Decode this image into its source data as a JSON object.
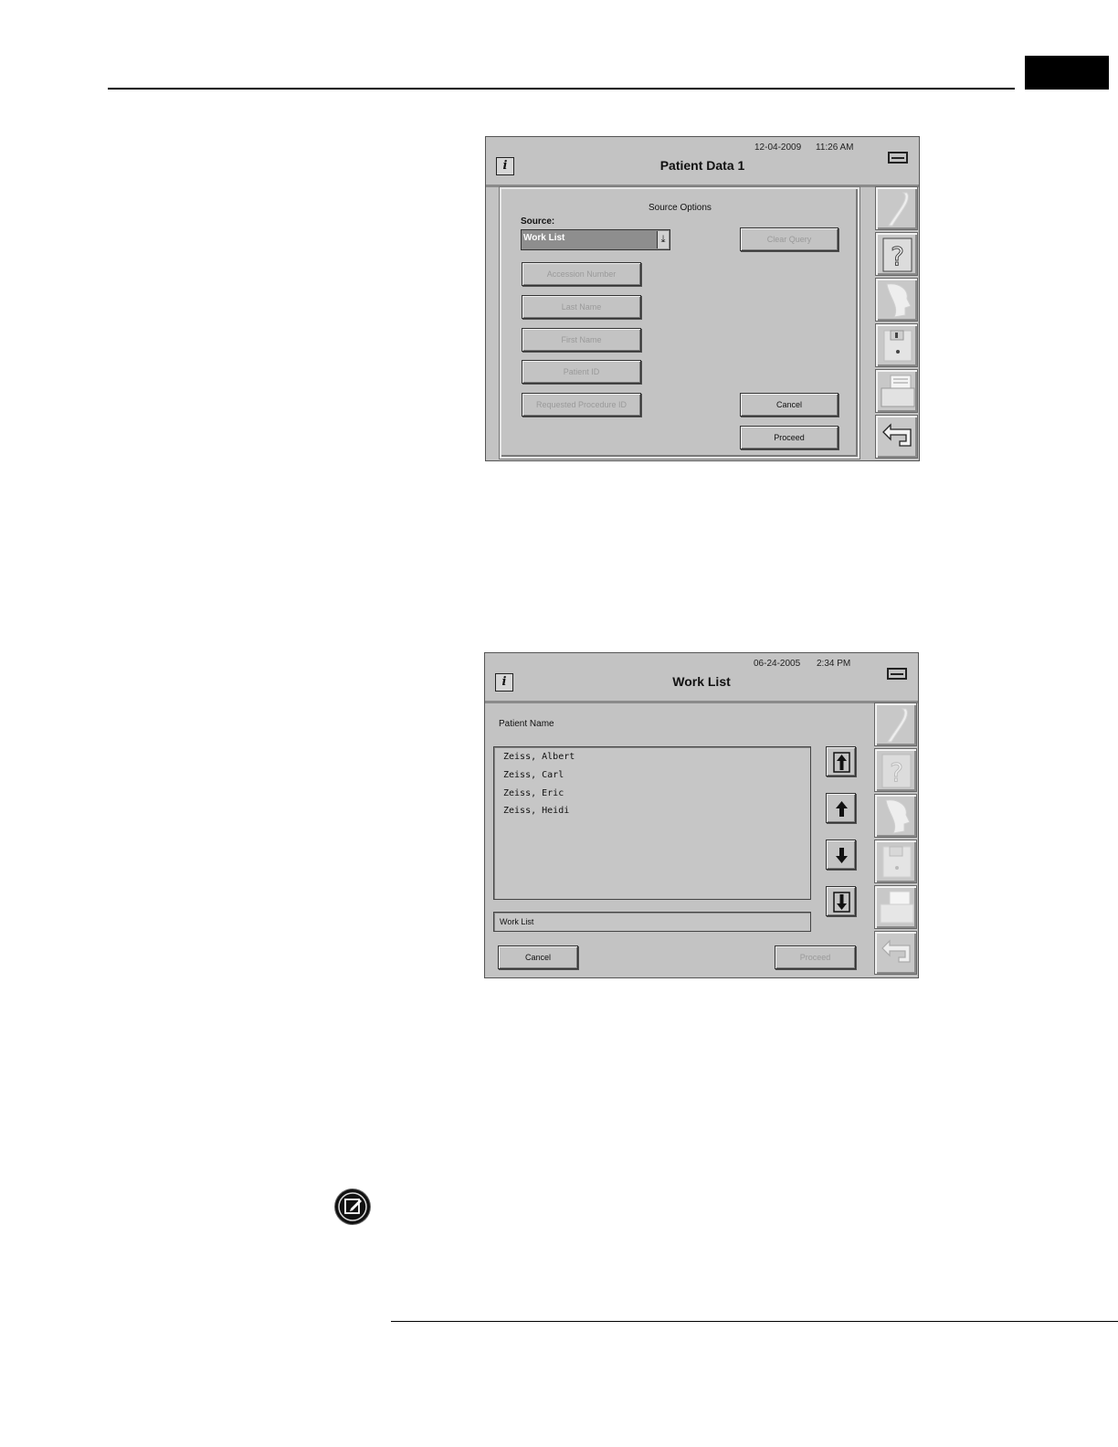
{
  "screen1": {
    "date": "12-04-2009",
    "time": "11:26 AM",
    "title": "Patient Data 1",
    "dialog": {
      "heading": "Source Options",
      "source_label": "Source:",
      "source_value": "Work List",
      "buttons": {
        "clear_query": "Clear Query",
        "accession_number": "Accession Number",
        "last_name": "Last Name",
        "first_name": "First Name",
        "patient_id": "Patient ID",
        "requested_procedure_id": "Requested Procedure ID",
        "cancel": "Cancel",
        "proceed": "Proceed"
      }
    }
  },
  "screen2": {
    "date": "06-24-2005",
    "time": "2:34 PM",
    "title": "Work List",
    "column_label": "Patient Name",
    "patients": [
      "Zeiss, Albert",
      "Zeiss, Carl",
      "Zeiss, Eric",
      "Zeiss, Heidi"
    ],
    "source_field": "Work List",
    "buttons": {
      "cancel": "Cancel",
      "proceed": "Proceed"
    }
  },
  "sidebar_icons": [
    "pen-icon",
    "help-icon",
    "patient-profile-icon",
    "disk-icon",
    "printer-icon",
    "return-icon"
  ]
}
